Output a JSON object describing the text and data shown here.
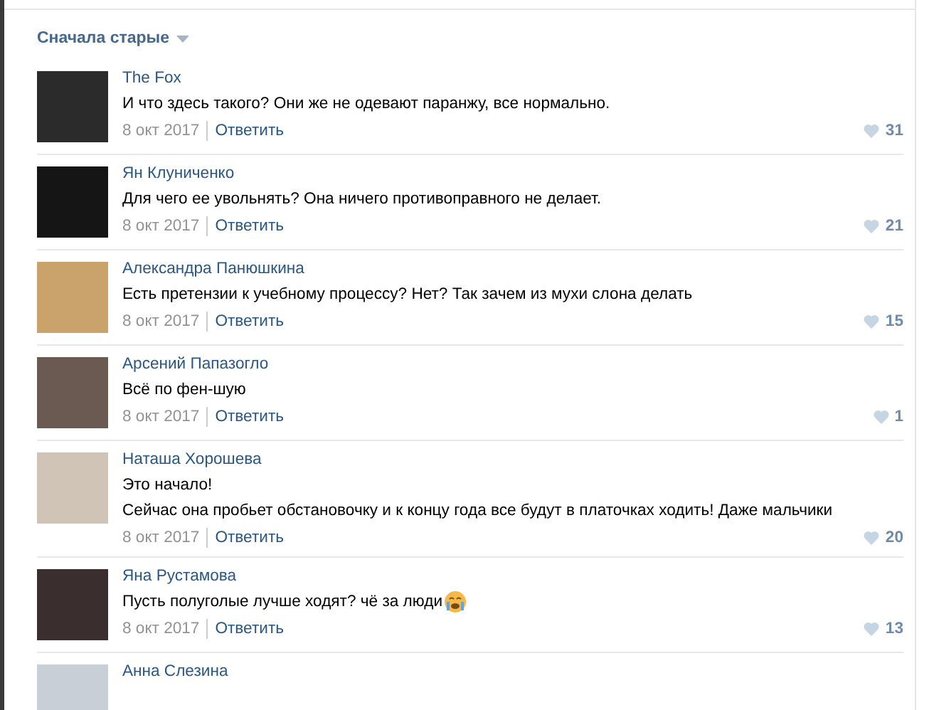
{
  "sort": {
    "label": "Сначала старые"
  },
  "comments": [
    {
      "author": "The Fox",
      "lines": [
        "И что здесь такого? Они же не одевают паранжу, все нормально."
      ],
      "emoji": false,
      "date": "8 окт 2017",
      "reply": "Ответить",
      "likes": "31"
    },
    {
      "author": "Ян Клуниченко",
      "lines": [
        "Для чего ее увольнять? Она ничего противоправного не делает."
      ],
      "emoji": false,
      "date": "8 окт 2017",
      "reply": "Ответить",
      "likes": "21"
    },
    {
      "author": "Александра Панюшкина",
      "lines": [
        "Есть претензии к учебному процессу? Нет? Так зачем из мухи слона делать"
      ],
      "emoji": false,
      "date": "8 окт 2017",
      "reply": "Ответить",
      "likes": "15"
    },
    {
      "author": "Арсений Папазогло",
      "lines": [
        "Всё по фен-шую"
      ],
      "emoji": false,
      "date": "8 окт 2017",
      "reply": "Ответить",
      "likes": "1"
    },
    {
      "author": "Наташа Хорошева",
      "lines": [
        "Это начало!",
        "Сейчас она пробьет обстановочку и к концу года все будут в платочках ходить! Даже мальчики"
      ],
      "emoji": false,
      "date": "8 окт 2017",
      "reply": "Ответить",
      "likes": "20"
    },
    {
      "author": "Яна Рустамова",
      "lines": [
        "Пусть полуголые лучше ходят? чё за люди"
      ],
      "emoji": true,
      "date": "8 окт 2017",
      "reply": "Ответить",
      "likes": "13"
    },
    {
      "author": "Анна Слезина"
    }
  ]
}
